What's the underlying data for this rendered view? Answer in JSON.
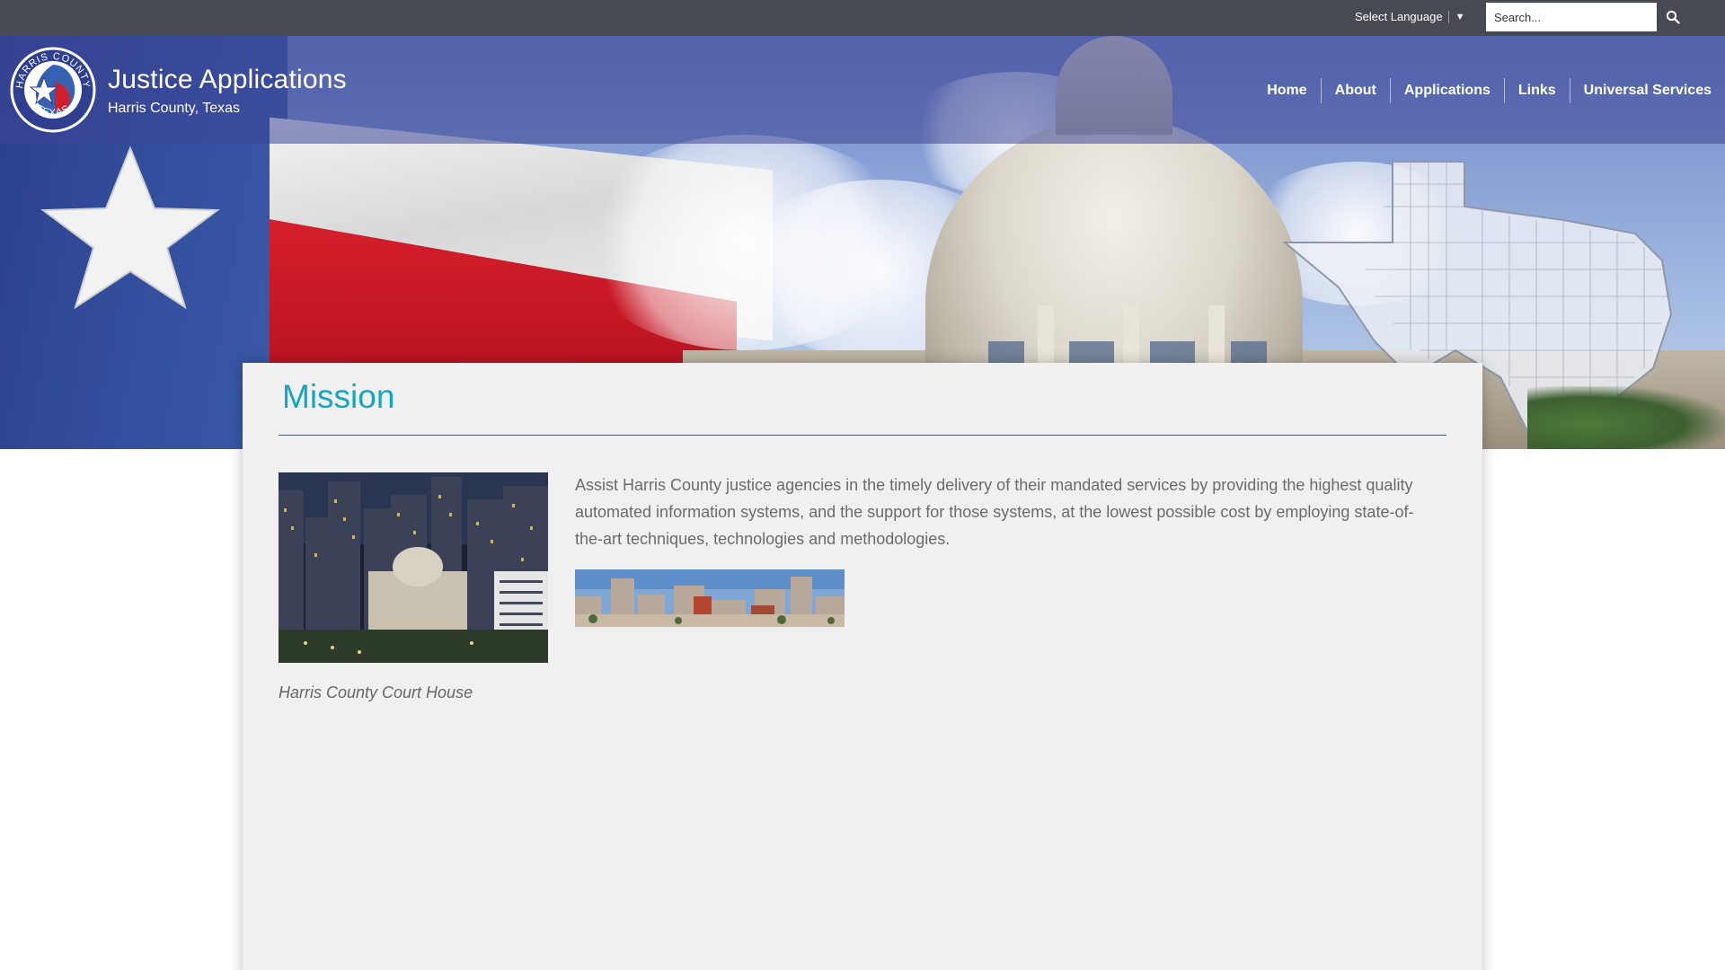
{
  "topbar": {
    "language_label": "Select Language",
    "language_caret": "▼",
    "search_placeholder": "Search...",
    "search_icon": "magnifier-icon"
  },
  "header": {
    "seal_alt": "Harris County Texas seal",
    "seal_text_top": "HARRIS COUNTY",
    "seal_text_bottom": "TEXAS",
    "title": "Justice Applications",
    "subtitle": "Harris County, Texas"
  },
  "nav": {
    "items": [
      {
        "label": "Home"
      },
      {
        "label": "About"
      },
      {
        "label": "Applications"
      },
      {
        "label": "Links"
      },
      {
        "label": "Universal Services"
      }
    ]
  },
  "main": {
    "heading": "Mission",
    "text": "Assist Harris County justice agencies in the timely delivery of their mandated services by providing the highest quality automated information systems, and the support for those systems, at the lowest possible cost by employing state-of-the-art techniques, technologies and methodologies.",
    "photo_caption": "Harris County Court House"
  },
  "colors": {
    "topbar": "#474a52",
    "accent_heading": "#16a6c0",
    "panel_bg": "#f0f0f0",
    "body_text": "#6b6b6b"
  }
}
